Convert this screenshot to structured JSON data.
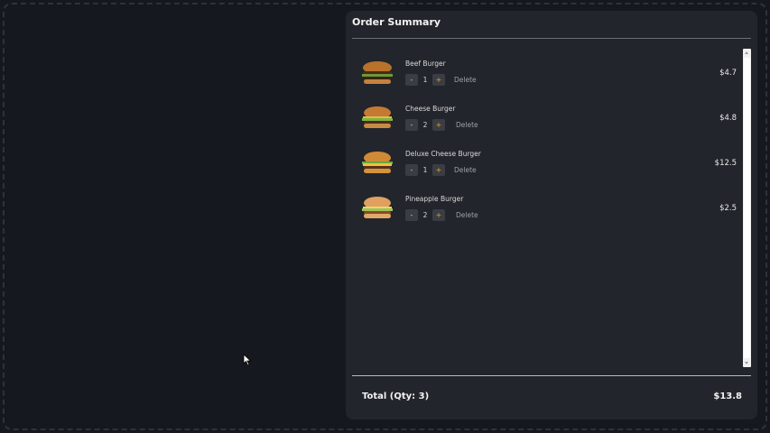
{
  "order_summary": {
    "title": "Order Summary",
    "items": [
      {
        "name": "Beef Burger",
        "qty": "1",
        "minus": "-",
        "plus": "+",
        "delete": "Delete",
        "price": "$4.7",
        "icon": "burger-image"
      },
      {
        "name": "Cheese Burger",
        "qty": "2",
        "minus": "-",
        "plus": "+",
        "delete": "Delete",
        "price": "$4.8",
        "icon": "burger-image"
      },
      {
        "name": "Deluxe Cheese Burger",
        "qty": "1",
        "minus": "-",
        "plus": "+",
        "delete": "Delete",
        "price": "$12.5",
        "icon": "burger-image"
      },
      {
        "name": "Pineapple Burger",
        "qty": "2",
        "minus": "-",
        "plus": "+",
        "delete": "Delete",
        "price": "$2.5",
        "icon": "burger-image"
      }
    ],
    "total_label": "Total (Qty: 3)",
    "total_value": "$13.8"
  },
  "colors": {
    "background": "#15181e",
    "panel": "#22252b",
    "accent": "#e3a32a"
  }
}
